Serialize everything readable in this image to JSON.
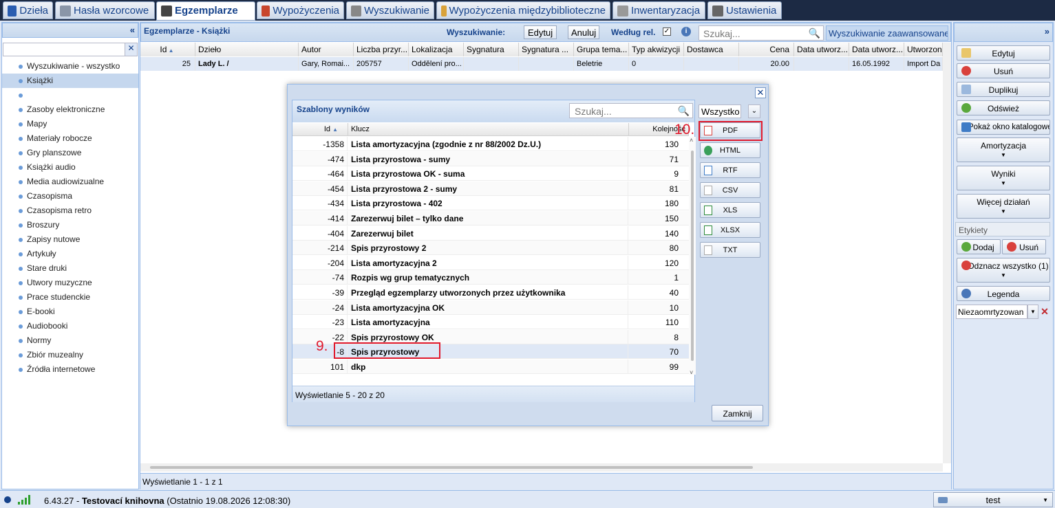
{
  "tabs": [
    {
      "label": "Dzieła",
      "icon": "book-icon"
    },
    {
      "label": "Hasła wzorcowe",
      "icon": "card-icon"
    },
    {
      "label": "Egzemplarze",
      "icon": "pen-icon"
    },
    {
      "label": "Wypożyczenia",
      "icon": "books-icon"
    },
    {
      "label": "Wyszukiwanie",
      "icon": "search-doc-icon"
    },
    {
      "label": "Wypożyczenia międzybiblioteczne",
      "icon": "package-icon"
    },
    {
      "label": "Inwentaryzacja",
      "icon": "list-icon"
    },
    {
      "label": "Ustawienia",
      "icon": "tools-icon"
    }
  ],
  "sidebar": {
    "items": [
      "Wyszukiwanie - wszystko",
      "Książki",
      "",
      "Zasoby elektroniczne",
      "Mapy",
      "Materiały robocze",
      "Gry planszowe",
      "Książki audio",
      "Media audiowizualne",
      "Czasopisma",
      "Czasopisma retro",
      "Broszury",
      "Zapisy nutowe",
      "Artykuły",
      "Stare druki",
      "Utwory muzyczne",
      "Prace studenckie",
      "E-booki",
      "Audiobooki",
      "Normy",
      "Zbiór muzealny",
      "Źródła internetowe"
    ],
    "selected_index": 1
  },
  "center": {
    "title": "Egzemplarze - Książki",
    "search_label": "Wyszukiwanie:",
    "edit_btn": "Edytuj",
    "cancel_btn": "Anuluj",
    "relevance_label": "Według rel.",
    "search_placeholder": "Szukaj...",
    "advanced_btn": "Wyszukiwanie zaawansowane",
    "columns": [
      "Id",
      "Dzieło",
      "Autor",
      "Liczba przyr...",
      "Lokalizacja",
      "Sygnatura",
      "Sygnatura ...",
      "Grupa tema...",
      "Typ akwizycji",
      "Dostawca",
      "Cena",
      "Data utworz...",
      "Data utworz...",
      "Utworzone ..."
    ],
    "row": [
      "25",
      "Lady L. /",
      "Gary, Romai...",
      "205757",
      "Oddělení pro...",
      "",
      "",
      "Beletrie",
      "0",
      "",
      "20.00",
      "",
      "16.05.1992",
      "Import Da"
    ],
    "footer": "Wyświetlanie 1 - 1 z 1"
  },
  "right": {
    "edit": "Edytuj",
    "delete": "Usuń",
    "duplicate": "Duplikuj",
    "refresh": "Odśwież",
    "catalog": "Pokaż okno katalogowe",
    "amort": "Amortyzacja",
    "results": "Wyniki",
    "more": "Więcej działań",
    "labels_section": "Etykiety",
    "add": "Dodaj",
    "remove": "Usuń",
    "unmark": "Odznacz wszystko (1)",
    "legend": "Legenda",
    "filter_value": "Niezaomrtyzowan"
  },
  "status": {
    "version": "6.43.27",
    "library": "Testovací knihovna",
    "last": "(Ostatnio 19.08.2026 12:08:30)",
    "user": "test"
  },
  "dialog": {
    "title": "Szablony wyników",
    "search_placeholder": "Szukaj...",
    "filter_value": "Wszystko",
    "col_id": "Id",
    "col_key": "Klucz",
    "col_order": "Kolejność",
    "rows": [
      {
        "id": "-1358",
        "key": "Lista amortyzacyjna (zgodnie z nr 88/2002 Dz.U.)",
        "order": "130"
      },
      {
        "id": "-474",
        "key": "Lista przyrostowa - sumy",
        "order": "71"
      },
      {
        "id": "-464",
        "key": "Lista przyrostowa OK - suma",
        "order": "9"
      },
      {
        "id": "-454",
        "key": "Lista przyrostowa 2 - sumy",
        "order": "81"
      },
      {
        "id": "-434",
        "key": "Lista przyrostowa - 402",
        "order": "180"
      },
      {
        "id": "-414",
        "key": "Zarezerwuj bilet – tylko dane",
        "order": "150"
      },
      {
        "id": "-404",
        "key": "Zarezerwuj bilet",
        "order": "140"
      },
      {
        "id": "-214",
        "key": "Spis przyrostowy 2",
        "order": "80"
      },
      {
        "id": "-204",
        "key": "Lista amortyzacyjna 2",
        "order": "120"
      },
      {
        "id": "-74",
        "key": "Rozpis wg grup tematycznych",
        "order": "1"
      },
      {
        "id": "-39",
        "key": "Przegląd egzemplarzy utworzonych przez użytkownika",
        "order": "40"
      },
      {
        "id": "-24",
        "key": "Lista amortyzacyjna OK",
        "order": "10"
      },
      {
        "id": "-23",
        "key": "Lista amortyzacyjna",
        "order": "110"
      },
      {
        "id": "-22",
        "key": "Spis przyrostowy OK",
        "order": "8"
      },
      {
        "id": "-8",
        "key": "Spis przyrostowy",
        "order": "70"
      },
      {
        "id": "101",
        "key": "dkp",
        "order": "99"
      }
    ],
    "highlight_index": 14,
    "footer": "Wyświetlanie 5 - 20 z 20",
    "export": [
      "PDF",
      "HTML",
      "RTF",
      "CSV",
      "XLS",
      "XLSX",
      "TXT"
    ],
    "close_btn": "Zamknij",
    "step9": "9.",
    "step10": "10."
  }
}
